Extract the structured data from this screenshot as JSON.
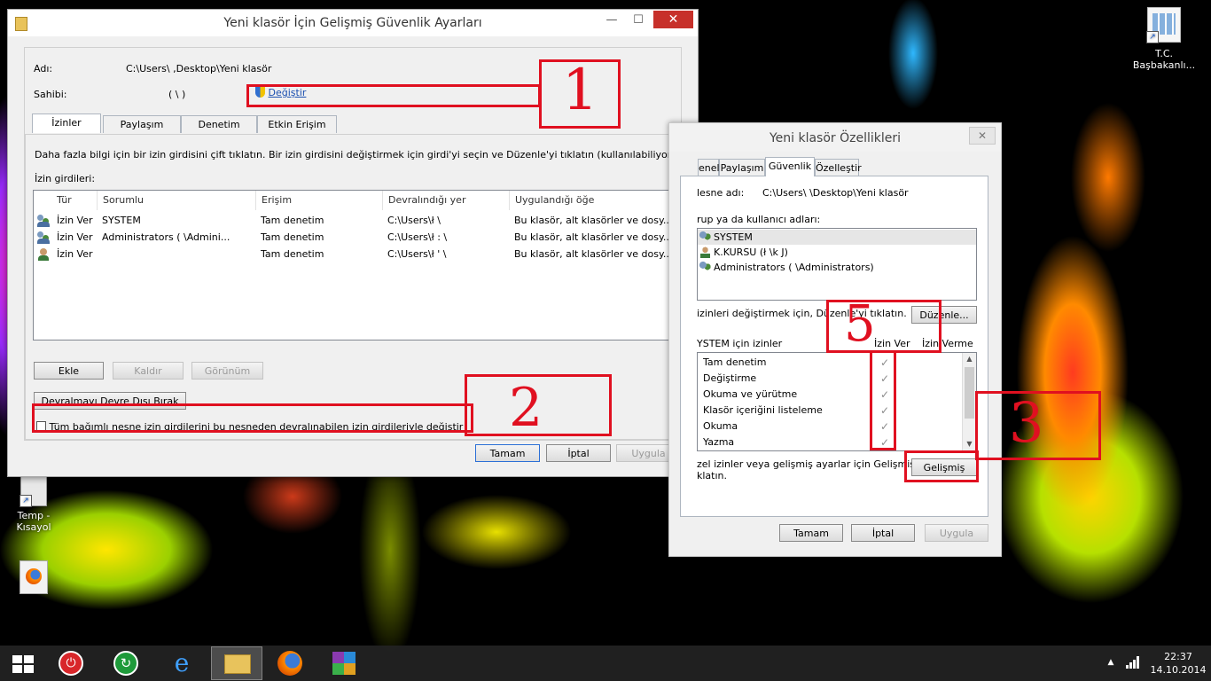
{
  "desktop": {
    "icons": [
      {
        "name": "tc-basbakanlik-shortcut",
        "line1": "T.C.",
        "line2": "Başbakanlı..."
      },
      {
        "name": "temp-shortcut",
        "line1": "Temp -",
        "line2": "Kısayol"
      },
      {
        "name": "firefox-file",
        "line1": "",
        "line2": ""
      }
    ]
  },
  "adv": {
    "title": "Yeni klasör İçin Gelişmiş Güvenlik Ayarları",
    "name_label": "Adı:",
    "name_value": "C:\\Users\\              ,Desktop\\Yeni klasör",
    "owner_label": "Sahibi:",
    "owner_value": "(        \\            )",
    "change_link": "Değiştir",
    "tabs": [
      "İzinler",
      "Paylaşım",
      "Denetim",
      "Etkin Erişim"
    ],
    "info": "Daha fazla bilgi için bir izin girdisini çift tıklatın. Bir izin girdisini değiştirmek için girdi'yi seçin ve Düzenle'yi tıklatın (kullanılabiliyorsa).",
    "entries_label": "İzin girdileri:",
    "columns": [
      "Tür",
      "Sorumlu",
      "Erişim",
      "Devralındığı yer",
      "Uygulandığı öğe"
    ],
    "rows": [
      {
        "type": "İzin Ver",
        "principal": "SYSTEM",
        "access": "Tam denetim",
        "inherited": "C:\\Users\\ł            \\",
        "applies": "Bu klasör, alt klasörler ve dosy..."
      },
      {
        "type": "İzin Ver",
        "principal": "Administrators (          \\Admini...",
        "access": "Tam denetim",
        "inherited": "C:\\Users\\ł          :    \\",
        "applies": "Bu klasör, alt klasörler ve dosy..."
      },
      {
        "type": "İzin Ver",
        "principal": "",
        "access": "Tam denetim",
        "inherited": "C:\\Users\\ł          '    \\",
        "applies": "Bu klasör, alt klasörler ve dosy..."
      }
    ],
    "add": "Ekle",
    "remove": "Kaldır",
    "view": "Görünüm",
    "disable_inheritance": "Devralmayı Devre Dışı Bırak",
    "replace_checkbox": "Tüm bağımlı nesne izin girdilerini bu nesneden devralınabilen izin girdileriyle değiştir",
    "ok": "Tamam",
    "cancel": "İptal",
    "apply": "Uygula"
  },
  "props": {
    "title": "Yeni klasör Özellikleri",
    "tabs": [
      "enel",
      "Paylaşım",
      "Güvenlik",
      "Özelleştir"
    ],
    "object_label": "lesne adı:",
    "object_value": "C:\\Users\\              \\Desktop\\Yeni klasör",
    "group_label": "rup ya da kullanıcı adları:",
    "users": [
      "SYSTEM",
      "K.KURSU (ł           \\k             J)",
      "Administrators (              \\Administrators)"
    ],
    "edit_hint": "izinleri değiştirmek için, Düzenle'yi tıklatın.",
    "edit": "Düzenle...",
    "perm_header": "YSTEM için izinler",
    "allow": "İzin Ver",
    "deny": "İzin Verme",
    "permissions": [
      "Tam denetim",
      "Değiştirme",
      "Okuma ve yürütme",
      "Klasör içeriğini listeleme",
      "Okuma",
      "Yazma"
    ],
    "adv_hint_1": "zel izinler veya gelişmiş ayarlar için Gelişmiş'i",
    "adv_hint_2": "klatın.",
    "advanced": "Gelişmiş",
    "ok": "Tamam",
    "cancel": "İptal",
    "apply": "Uygula"
  },
  "annotations": [
    "1",
    "2",
    "3",
    "5"
  ],
  "tray": {
    "time": "22:37",
    "date": "14.10.2014"
  },
  "colors": {
    "annotation": "#e01020",
    "accent": "#2b6fd6"
  }
}
